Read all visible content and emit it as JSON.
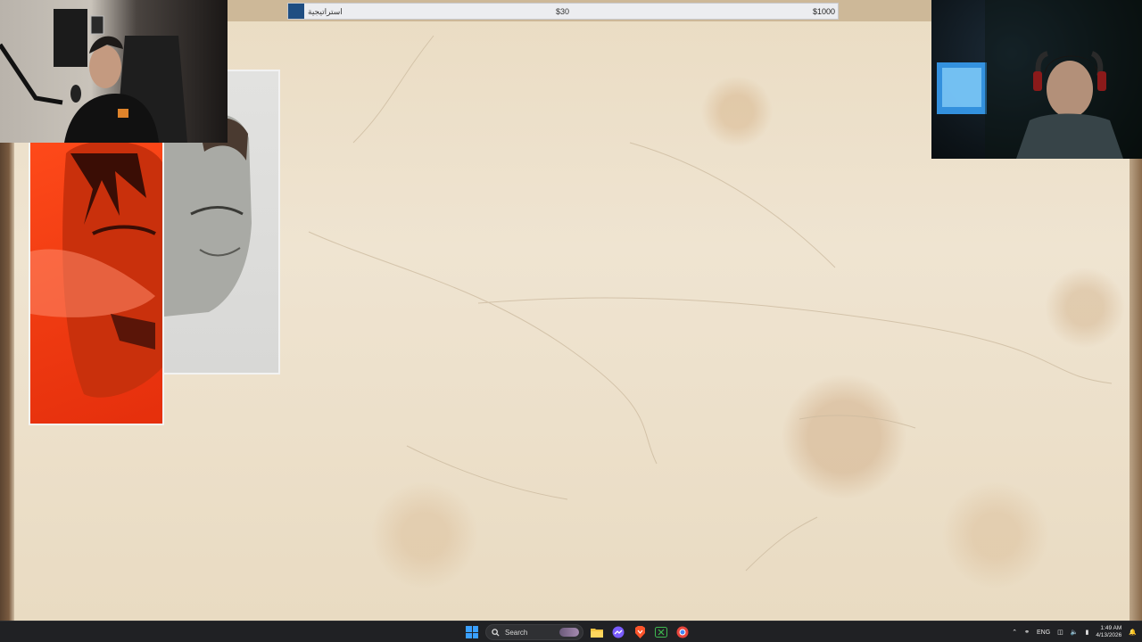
{
  "game": {
    "slider": {
      "min_label": "استراتيجية",
      "mid_label": "$30",
      "max_label": "$1000",
      "value_fraction": 0.0
    }
  },
  "taskbar": {
    "search_label": "Search",
    "language": "ENG",
    "time": "1:49 AM",
    "date": "4/13/2026",
    "icons": [
      "windows-start-icon",
      "search-icon",
      "file-explorer-icon",
      "messenger-icon",
      "brave-browser-icon",
      "xbox-icon",
      "chrome-icon"
    ]
  },
  "colors": {
    "slider_thumb": "#1f4e82",
    "poster_red": "#f03c12",
    "taskbar_bg": "#202124",
    "start_blue": "#3aa0ff"
  }
}
